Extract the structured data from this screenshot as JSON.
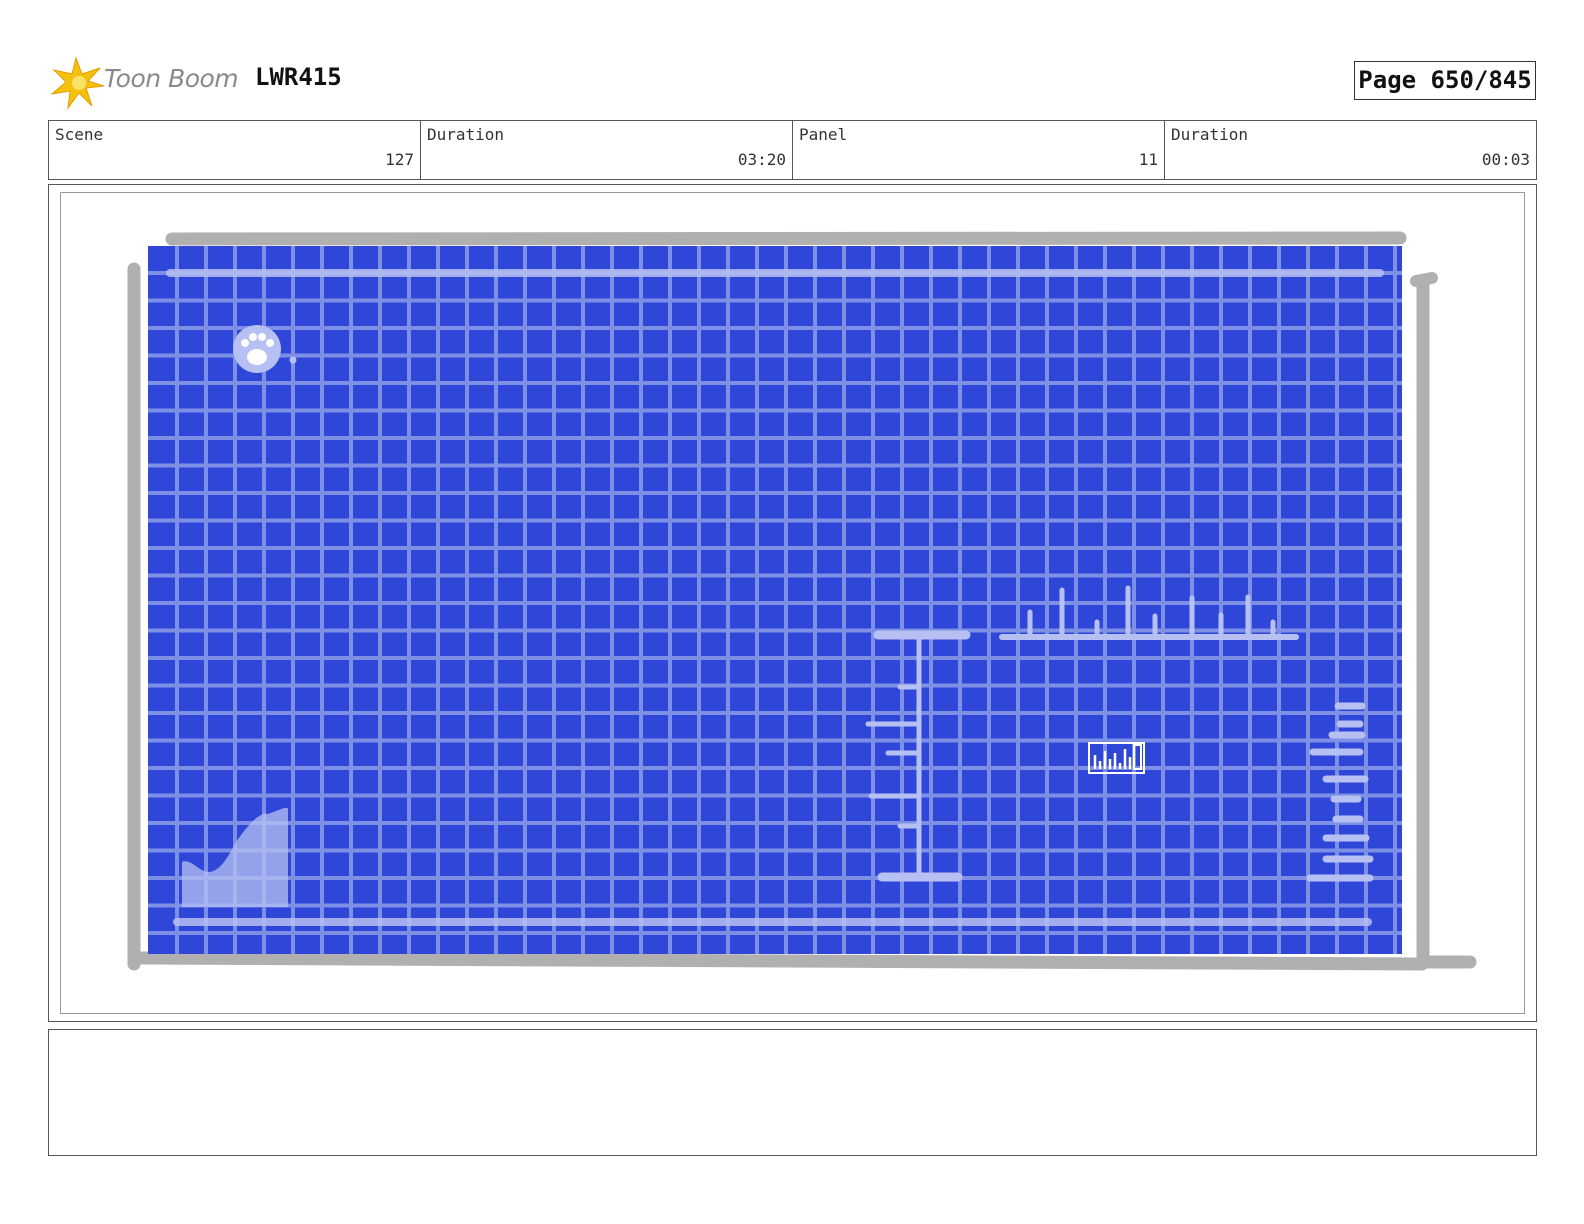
{
  "header": {
    "logo_text": "Toon Boom",
    "project_code": "LWR415",
    "page_label": "Page 650/845"
  },
  "info": {
    "scene_label": "Scene",
    "scene_value": "127",
    "scene_duration_label": "Duration",
    "scene_duration_value": "03:20",
    "panel_label": "Panel",
    "panel_value": "11",
    "panel_duration_label": "Duration",
    "panel_duration_value": "00:03"
  },
  "panel": {
    "screen_color": "#2f47d8",
    "grid_color": "#7e8fe6",
    "ui_color": "#b7c0f2",
    "frame_color": "#b0b0b0",
    "icons": [
      "paw-icon",
      "bar-chart-icon"
    ]
  },
  "notes": {
    "text": ""
  }
}
